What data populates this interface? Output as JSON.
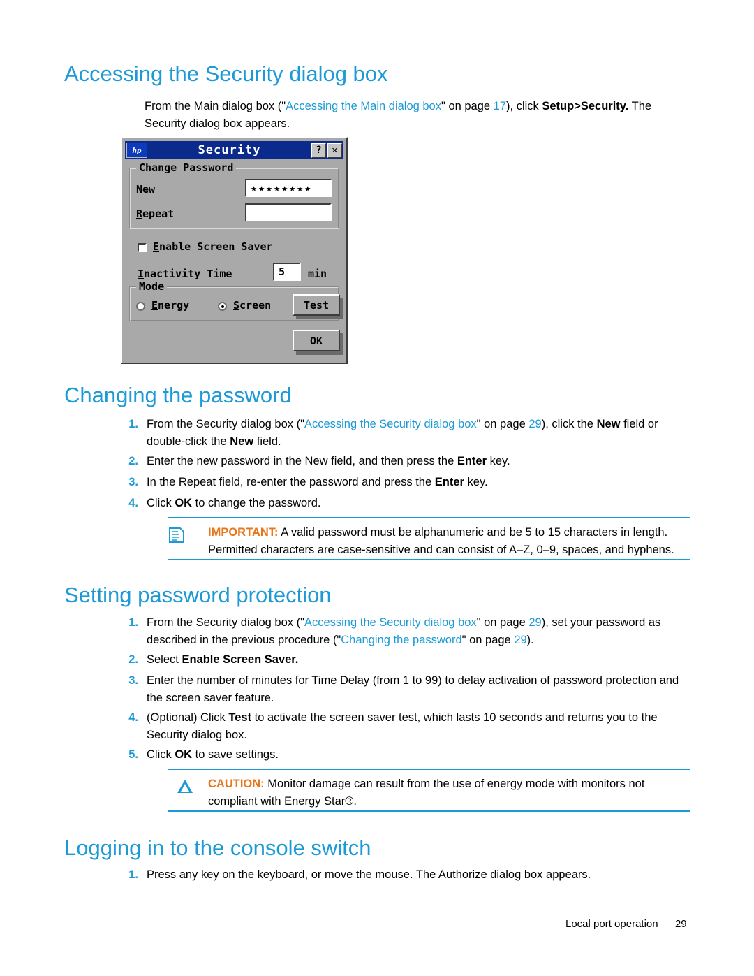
{
  "sections": {
    "accessing": {
      "title": "Accessing the Security dialog box",
      "intro_a": "From the Main dialog box (\"",
      "intro_link": "Accessing the Main dialog box",
      "intro_b": "\" on page ",
      "intro_page": "17",
      "intro_c": "), click ",
      "intro_bold": "Setup>Security.",
      "intro_d": " The Security dialog box appears."
    },
    "changing": {
      "title": "Changing the password",
      "items": [
        {
          "num": "1.",
          "parts": [
            {
              "t": "From the Security dialog box (\"",
              "s": "plain"
            },
            {
              "t": "Accessing the Security dialog box",
              "s": "link"
            },
            {
              "t": "\" on page ",
              "s": "plain"
            },
            {
              "t": "29",
              "s": "link"
            },
            {
              "t": "), click the ",
              "s": "plain"
            },
            {
              "t": "New",
              "s": "bold"
            },
            {
              "t": " field or double-click the ",
              "s": "plain"
            },
            {
              "t": "New",
              "s": "bold"
            },
            {
              "t": " field.",
              "s": "plain"
            }
          ]
        },
        {
          "num": "2.",
          "parts": [
            {
              "t": "Enter the new password in the New field, and then press the ",
              "s": "plain"
            },
            {
              "t": "Enter",
              "s": "bold"
            },
            {
              "t": " key.",
              "s": "plain"
            }
          ]
        },
        {
          "num": "3.",
          "parts": [
            {
              "t": "In the Repeat field, re-enter the password and press the ",
              "s": "plain"
            },
            {
              "t": "Enter",
              "s": "bold"
            },
            {
              "t": " key.",
              "s": "plain"
            }
          ]
        },
        {
          "num": "4.",
          "parts": [
            {
              "t": "Click ",
              "s": "plain"
            },
            {
              "t": "OK",
              "s": "bold"
            },
            {
              "t": " to change the password.",
              "s": "plain"
            }
          ]
        }
      ],
      "important": {
        "label": "IMPORTANT:",
        "text": " A valid password must be alphanumeric and be 5 to 15 characters in length. Permitted characters are case-sensitive and can consist of A–Z, 0–9, spaces, and hyphens."
      }
    },
    "setting": {
      "title": "Setting password protection",
      "items": [
        {
          "num": "1.",
          "parts": [
            {
              "t": "From the Security dialog box (\"",
              "s": "plain"
            },
            {
              "t": "Accessing the Security dialog box",
              "s": "link"
            },
            {
              "t": "\" on page ",
              "s": "plain"
            },
            {
              "t": "29",
              "s": "link"
            },
            {
              "t": "), set your password as described in the previous procedure (\"",
              "s": "plain"
            },
            {
              "t": "Changing the password",
              "s": "link"
            },
            {
              "t": "\" on page ",
              "s": "plain"
            },
            {
              "t": "29",
              "s": "link"
            },
            {
              "t": ").",
              "s": "plain"
            }
          ]
        },
        {
          "num": "2.",
          "parts": [
            {
              "t": "Select ",
              "s": "plain"
            },
            {
              "t": "Enable Screen Saver.",
              "s": "bold"
            }
          ]
        },
        {
          "num": "3.",
          "parts": [
            {
              "t": "Enter the number of minutes for Time Delay (from 1 to 99) to delay activation of password protection and the screen saver feature.",
              "s": "plain"
            }
          ]
        },
        {
          "num": "4.",
          "parts": [
            {
              "t": "(Optional) Click ",
              "s": "plain"
            },
            {
              "t": "Test",
              "s": "bold"
            },
            {
              "t": " to activate the screen saver test, which lasts 10 seconds and returns you to the Security dialog box.",
              "s": "plain"
            }
          ]
        },
        {
          "num": "5.",
          "parts": [
            {
              "t": "Click ",
              "s": "plain"
            },
            {
              "t": "OK",
              "s": "bold"
            },
            {
              "t": " to save settings.",
              "s": "plain"
            }
          ]
        }
      ],
      "caution": {
        "label": "CAUTION:",
        "text": "  Monitor damage can result from the use of energy mode with monitors not compliant with Energy Star®."
      }
    },
    "logging": {
      "title": "Logging in to the console switch",
      "items": [
        {
          "num": "1.",
          "parts": [
            {
              "t": "Press any key on the keyboard, or move the mouse. The Authorize dialog box appears.",
              "s": "plain"
            }
          ]
        }
      ]
    }
  },
  "dialog": {
    "logo_text": "hp",
    "title": "Security",
    "help_button": "?",
    "close_button": "✕",
    "group_change_password": "Change Password",
    "label_new": "New",
    "label_repeat": "Repeat",
    "value_new": "★★★★★★★★",
    "value_repeat": "",
    "checkbox_enable_screen_saver": "Enable Screen Saver",
    "label_inactivity_time": "Inactivity Time",
    "value_inactivity_time": "5",
    "unit_min": "min",
    "group_mode": "Mode",
    "radio_energy": "Energy",
    "radio_screen": "Screen",
    "button_test": "Test",
    "button_ok": "OK"
  },
  "footer": {
    "text": "Local port operation",
    "page": "29"
  },
  "colors": {
    "accent": "#1b9ad6",
    "warning": "#e8761b",
    "dialog_face": "#a9a9a9",
    "titlebar": "#0a2a8c"
  }
}
